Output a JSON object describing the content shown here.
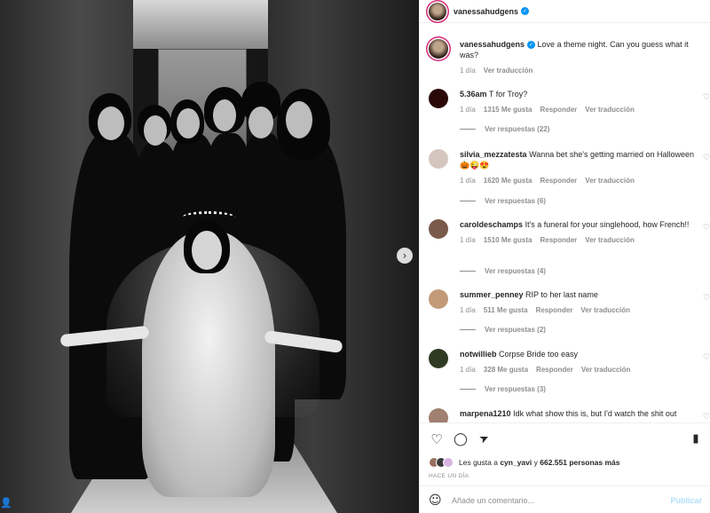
{
  "post": {
    "username": "vanessahudgens",
    "verified_icon": "verified-badge-icon",
    "caption": "Love a theme night. Can you guess what it was?",
    "caption_time": "1 día",
    "caption_translate": "Ver traducción"
  },
  "photo": {
    "next_icon": "chevron-right-icon",
    "next_glyph": "›",
    "profile_glyph": "👤"
  },
  "comments": [
    {
      "username": "5.36am",
      "text": "T for Troy?",
      "time": "1 día",
      "likes": "1315 Me gusta",
      "reply": "Responder",
      "translate": "Ver traducción",
      "replies": "Ver respuestas (22)",
      "avatar_color": "#3a0a0a"
    },
    {
      "username": "silvia_mezzatesta",
      "text": "Wanna bet she's getting married on Halloween 🎃😜😍",
      "time": "1 día",
      "likes": "1620 Me gusta",
      "reply": "Responder",
      "translate": "Ver traducción",
      "replies": "Ver respuestas (6)",
      "avatar_color": "#c9b8b0"
    },
    {
      "username": "caroldeschamps",
      "text": "It's a funeral for your singlehood, how French!!",
      "time": "1 día",
      "likes": "1510 Me gusta",
      "reply": "Responder",
      "translate": "Ver traducción",
      "replies": "Ver respuestas (4)",
      "avatar_color": "#8a6a5a"
    },
    {
      "username": "summer_penney",
      "text": "RIP to her last name",
      "time": "1 día",
      "likes": "511 Me gusta",
      "reply": "Responder",
      "translate": "Ver traducción",
      "replies": "Ver respuestas (2)",
      "avatar_color": "#b89070"
    },
    {
      "username": "notwillieb",
      "text": "Corpse Bride too easy",
      "time": "1 día",
      "likes": "328 Me gusta",
      "reply": "Responder",
      "translate": "Ver traducción",
      "replies": "Ver respuestas (3)",
      "avatar_color": "#3a4a2a"
    },
    {
      "username": "marpena1210",
      "text": "Idk what show this is, but I'd watch the shit out",
      "avatar_color": "#a08070"
    }
  ],
  "actions": {
    "like_icon": "heart-icon",
    "like_glyph": "♡",
    "comment_icon": "comment-icon",
    "comment_glyph": "◯",
    "share_icon": "send-icon",
    "share_glyph": "➤",
    "save_icon": "bookmark-icon",
    "save_glyph": "▮"
  },
  "likes": {
    "prefix": "Les gusta a",
    "user": "cyn_yavi",
    "joiner": "y",
    "count": "662.551 personas más"
  },
  "date": "HACE UN DÍA",
  "add_comment": {
    "emoji_icon": "smiley-icon",
    "emoji_glyph": "☺",
    "placeholder": "Añade un comentario...",
    "post_label": "Publicar"
  },
  "heart_glyph": "♡",
  "colors": {
    "link_blue": "#0095f6",
    "muted": "#8e8e8e",
    "story_ring": "#d62976",
    "post_disabled": "#b2dffc"
  }
}
